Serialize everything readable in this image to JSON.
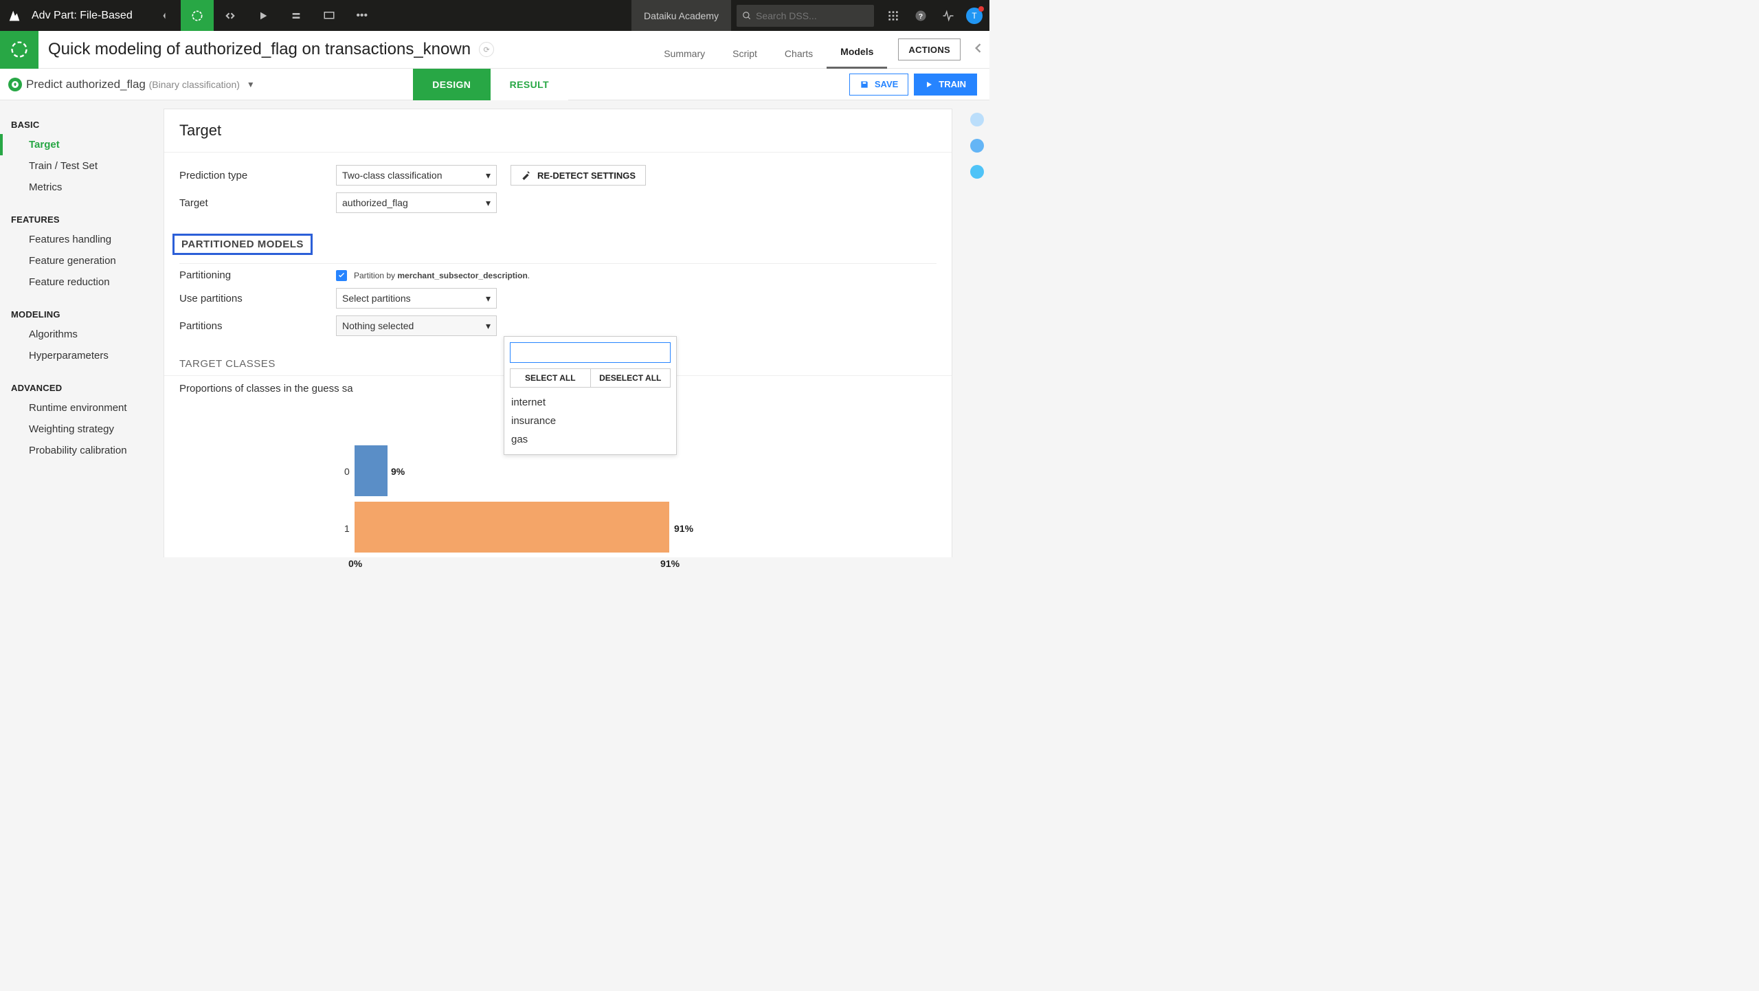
{
  "topbar": {
    "title": "Adv Part: File-Based",
    "academy": "Dataiku Academy",
    "search_placeholder": "Search DSS..."
  },
  "header": {
    "title": "Quick modeling of authorized_flag on transactions_known",
    "tabs": [
      "Summary",
      "Script",
      "Charts",
      "Models"
    ],
    "active_tab": "Models",
    "actions": "ACTIONS"
  },
  "subheader": {
    "task": "Predict authorized_flag",
    "subtask": "(Binary classification)",
    "design": "DESIGN",
    "result": "RESULT",
    "save": "SAVE",
    "train": "TRAIN"
  },
  "sidebar": {
    "groups": {
      "basic": "BASIC",
      "features": "FEATURES",
      "modeling": "MODELING",
      "advanced": "ADVANCED"
    },
    "items": {
      "target": "Target",
      "train_test": "Train / Test Set",
      "metrics": "Metrics",
      "feat_handling": "Features handling",
      "feat_gen": "Feature generation",
      "feat_red": "Feature reduction",
      "algorithms": "Algorithms",
      "hyperparams": "Hyperparameters",
      "runtime": "Runtime environment",
      "weighting": "Weighting strategy",
      "probcal": "Probability calibration"
    }
  },
  "panel": {
    "title": "Target",
    "prediction_type_lbl": "Prediction type",
    "prediction_type_val": "Two-class classification",
    "target_lbl": "Target",
    "target_val": "authorized_flag",
    "redetect": "RE-DETECT SETTINGS",
    "partitioned_models_heading": "PARTITIONED MODELS",
    "partitioning_lbl": "Partitioning",
    "partition_by_prefix": "Partition by ",
    "partition_by_col": "merchant_subsector_description",
    "use_partitions_lbl": "Use partitions",
    "use_partitions_val": "Select partitions",
    "partitions_lbl": "Partitions",
    "partitions_val": "Nothing selected",
    "dropdown": {
      "select_all": "SELECT ALL",
      "deselect_all": "DESELECT ALL",
      "options": [
        "internet",
        "insurance",
        "gas"
      ]
    },
    "target_classes_heading": "TARGET CLASSES",
    "target_classes_caption": "Proportions of classes in the guess sa"
  },
  "chart_data": {
    "type": "bar",
    "categories": [
      "0",
      "1"
    ],
    "values": [
      9,
      91
    ],
    "xlabel": "",
    "ylabel": "",
    "ylim": [
      0,
      91
    ],
    "series_labels": [
      "9%",
      "91%"
    ],
    "axis_ticks": [
      "0%",
      "91%"
    ]
  }
}
